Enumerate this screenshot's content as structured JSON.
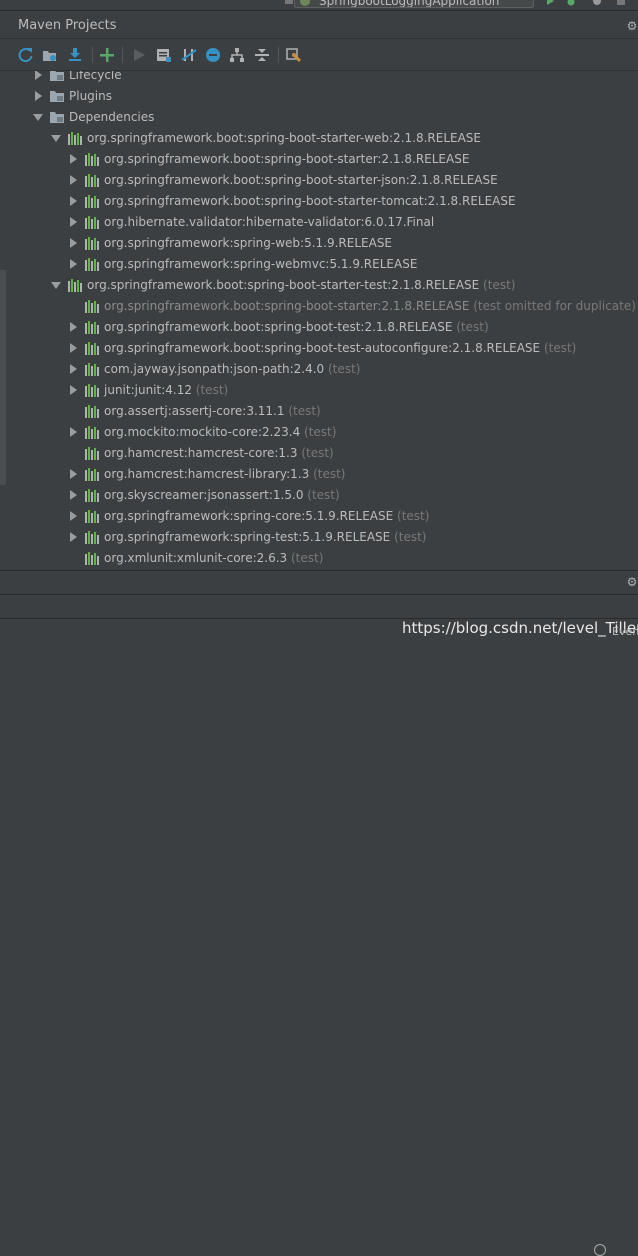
{
  "run_config": {
    "label": "SpringbootLoggingApplication"
  },
  "panel": {
    "title": "Maven Projects"
  },
  "toolbar": {
    "icons": [
      "refresh-icon",
      "generate-sources-icon",
      "download-icon",
      "add-icon",
      "run-icon",
      "execute-goal-icon",
      "toggle-offline-icon",
      "skip-tests-icon",
      "show-dependencies-icon",
      "collapse-all-icon",
      "settings-icon"
    ]
  },
  "tree": [
    {
      "label": "Lifecycle",
      "scope": "",
      "arrow": "right",
      "icon": "folder",
      "depth": 0,
      "dim": false
    },
    {
      "label": "Plugins",
      "scope": "",
      "arrow": "right",
      "icon": "folder",
      "depth": 0,
      "dim": false
    },
    {
      "label": "Dependencies",
      "scope": "",
      "arrow": "down",
      "icon": "folder",
      "depth": 0,
      "dim": false
    },
    {
      "label": "org.springframework.boot:spring-boot-starter-web:2.1.8.RELEASE",
      "scope": "",
      "arrow": "down",
      "icon": "library",
      "depth": 1,
      "dim": false
    },
    {
      "label": "org.springframework.boot:spring-boot-starter:2.1.8.RELEASE",
      "scope": "",
      "arrow": "right",
      "icon": "library",
      "depth": 2,
      "dim": false
    },
    {
      "label": "org.springframework.boot:spring-boot-starter-json:2.1.8.RELEASE",
      "scope": "",
      "arrow": "right",
      "icon": "library",
      "depth": 2,
      "dim": false
    },
    {
      "label": "org.springframework.boot:spring-boot-starter-tomcat:2.1.8.RELEASE",
      "scope": "",
      "arrow": "right",
      "icon": "library",
      "depth": 2,
      "dim": false
    },
    {
      "label": "org.hibernate.validator:hibernate-validator:6.0.17.Final",
      "scope": "",
      "arrow": "right",
      "icon": "library",
      "depth": 2,
      "dim": false
    },
    {
      "label": "org.springframework:spring-web:5.1.9.RELEASE",
      "scope": "",
      "arrow": "right",
      "icon": "library",
      "depth": 2,
      "dim": false
    },
    {
      "label": "org.springframework:spring-webmvc:5.1.9.RELEASE",
      "scope": "",
      "arrow": "right",
      "icon": "library",
      "depth": 2,
      "dim": false
    },
    {
      "label": "org.springframework.boot:spring-boot-starter-test:2.1.8.RELEASE",
      "scope": "(test)",
      "arrow": "down",
      "icon": "library",
      "depth": 1,
      "dim": false
    },
    {
      "label": "org.springframework.boot:spring-boot-starter:2.1.8.RELEASE",
      "scope": "(test omitted for duplicate)",
      "arrow": "none",
      "icon": "library",
      "depth": 2,
      "dim": true
    },
    {
      "label": "org.springframework.boot:spring-boot-test:2.1.8.RELEASE",
      "scope": "(test)",
      "arrow": "right",
      "icon": "library",
      "depth": 2,
      "dim": false
    },
    {
      "label": "org.springframework.boot:spring-boot-test-autoconfigure:2.1.8.RELEASE",
      "scope": "(test)",
      "arrow": "right",
      "icon": "library",
      "depth": 2,
      "dim": false
    },
    {
      "label": "com.jayway.jsonpath:json-path:2.4.0",
      "scope": "(test)",
      "arrow": "right",
      "icon": "library",
      "depth": 2,
      "dim": false
    },
    {
      "label": "junit:junit:4.12",
      "scope": "(test)",
      "arrow": "right",
      "icon": "library",
      "depth": 2,
      "dim": false
    },
    {
      "label": "org.assertj:assertj-core:3.11.1",
      "scope": "(test)",
      "arrow": "none",
      "icon": "library",
      "depth": 2,
      "dim": false
    },
    {
      "label": "org.mockito:mockito-core:2.23.4",
      "scope": "(test)",
      "arrow": "right",
      "icon": "library",
      "depth": 2,
      "dim": false
    },
    {
      "label": "org.hamcrest:hamcrest-core:1.3",
      "scope": "(test)",
      "arrow": "none",
      "icon": "library",
      "depth": 2,
      "dim": false
    },
    {
      "label": "org.hamcrest:hamcrest-library:1.3",
      "scope": "(test)",
      "arrow": "right",
      "icon": "library",
      "depth": 2,
      "dim": false
    },
    {
      "label": "org.skyscreamer:jsonassert:1.5.0",
      "scope": "(test)",
      "arrow": "right",
      "icon": "library",
      "depth": 2,
      "dim": false
    },
    {
      "label": "org.springframework:spring-core:5.1.9.RELEASE",
      "scope": "(test)",
      "arrow": "right",
      "icon": "library",
      "depth": 2,
      "dim": false
    },
    {
      "label": "org.springframework:spring-test:5.1.9.RELEASE",
      "scope": "(test)",
      "arrow": "right",
      "icon": "library",
      "depth": 2,
      "dim": false
    },
    {
      "label": "org.xmlunit:xmlunit-core:2.6.3",
      "scope": "(test)",
      "arrow": "none",
      "icon": "library",
      "depth": 2,
      "dim": false
    }
  ],
  "watermark": "https://blog.csdn.net/level_Tiller",
  "status": {
    "event_log": "Even"
  },
  "colors": {
    "background": "#3c3f41",
    "text": "#bbbbbb",
    "scope_text": "#787878",
    "library_icon_green": "#62b543",
    "library_icon_grey": "#afb1b3",
    "add_green": "#59a869",
    "refresh_blue": "#3592c4"
  }
}
